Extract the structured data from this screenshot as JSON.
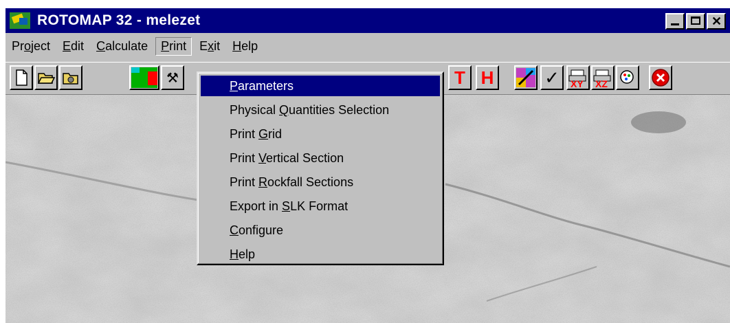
{
  "window": {
    "title": "ROTOMAP 32 - melezet"
  },
  "menubar": {
    "items": [
      {
        "pre": "Pr",
        "u": "o",
        "post": "ject"
      },
      {
        "pre": "",
        "u": "E",
        "post": "dit"
      },
      {
        "pre": "",
        "u": "C",
        "post": "alculate"
      },
      {
        "pre": "",
        "u": "P",
        "post": "rint"
      },
      {
        "pre": "E",
        "u": "x",
        "post": "it"
      },
      {
        "pre": "",
        "u": "H",
        "post": "elp"
      }
    ]
  },
  "toolbar": {
    "tool_t_label": "T",
    "tool_h_label": "H"
  },
  "print_menu": {
    "items": [
      {
        "pre": "",
        "u": "P",
        "post": "arameters",
        "selected": true
      },
      {
        "pre": "Physical ",
        "u": "Q",
        "post": "uantities Selection"
      },
      {
        "pre": "Print ",
        "u": "G",
        "post": "rid"
      },
      {
        "pre": "Print ",
        "u": "V",
        "post": "ertical Section"
      },
      {
        "pre": "Print ",
        "u": "R",
        "post": "ockfall Sections"
      },
      {
        "pre": "Export in ",
        "u": "S",
        "post": "LK Format"
      },
      {
        "pre": "",
        "u": "C",
        "post": "onfigure"
      },
      {
        "pre": "",
        "u": "H",
        "post": "elp"
      }
    ]
  },
  "colors": {
    "titlebar": "#000080",
    "face": "#c0c0c0",
    "selection": "#000080",
    "accent_red": "#ff0000"
  },
  "icons": [
    "app-map-icon",
    "new-file-icon",
    "open-folder-icon",
    "disk-folder-icon",
    "color-map-icon",
    "tools-icon",
    "letter-t-icon",
    "letter-h-icon",
    "color-tools-icon",
    "check-icon",
    "print-xy-icon",
    "print-xz-icon",
    "print-settings-icon",
    "exit-icon"
  ]
}
